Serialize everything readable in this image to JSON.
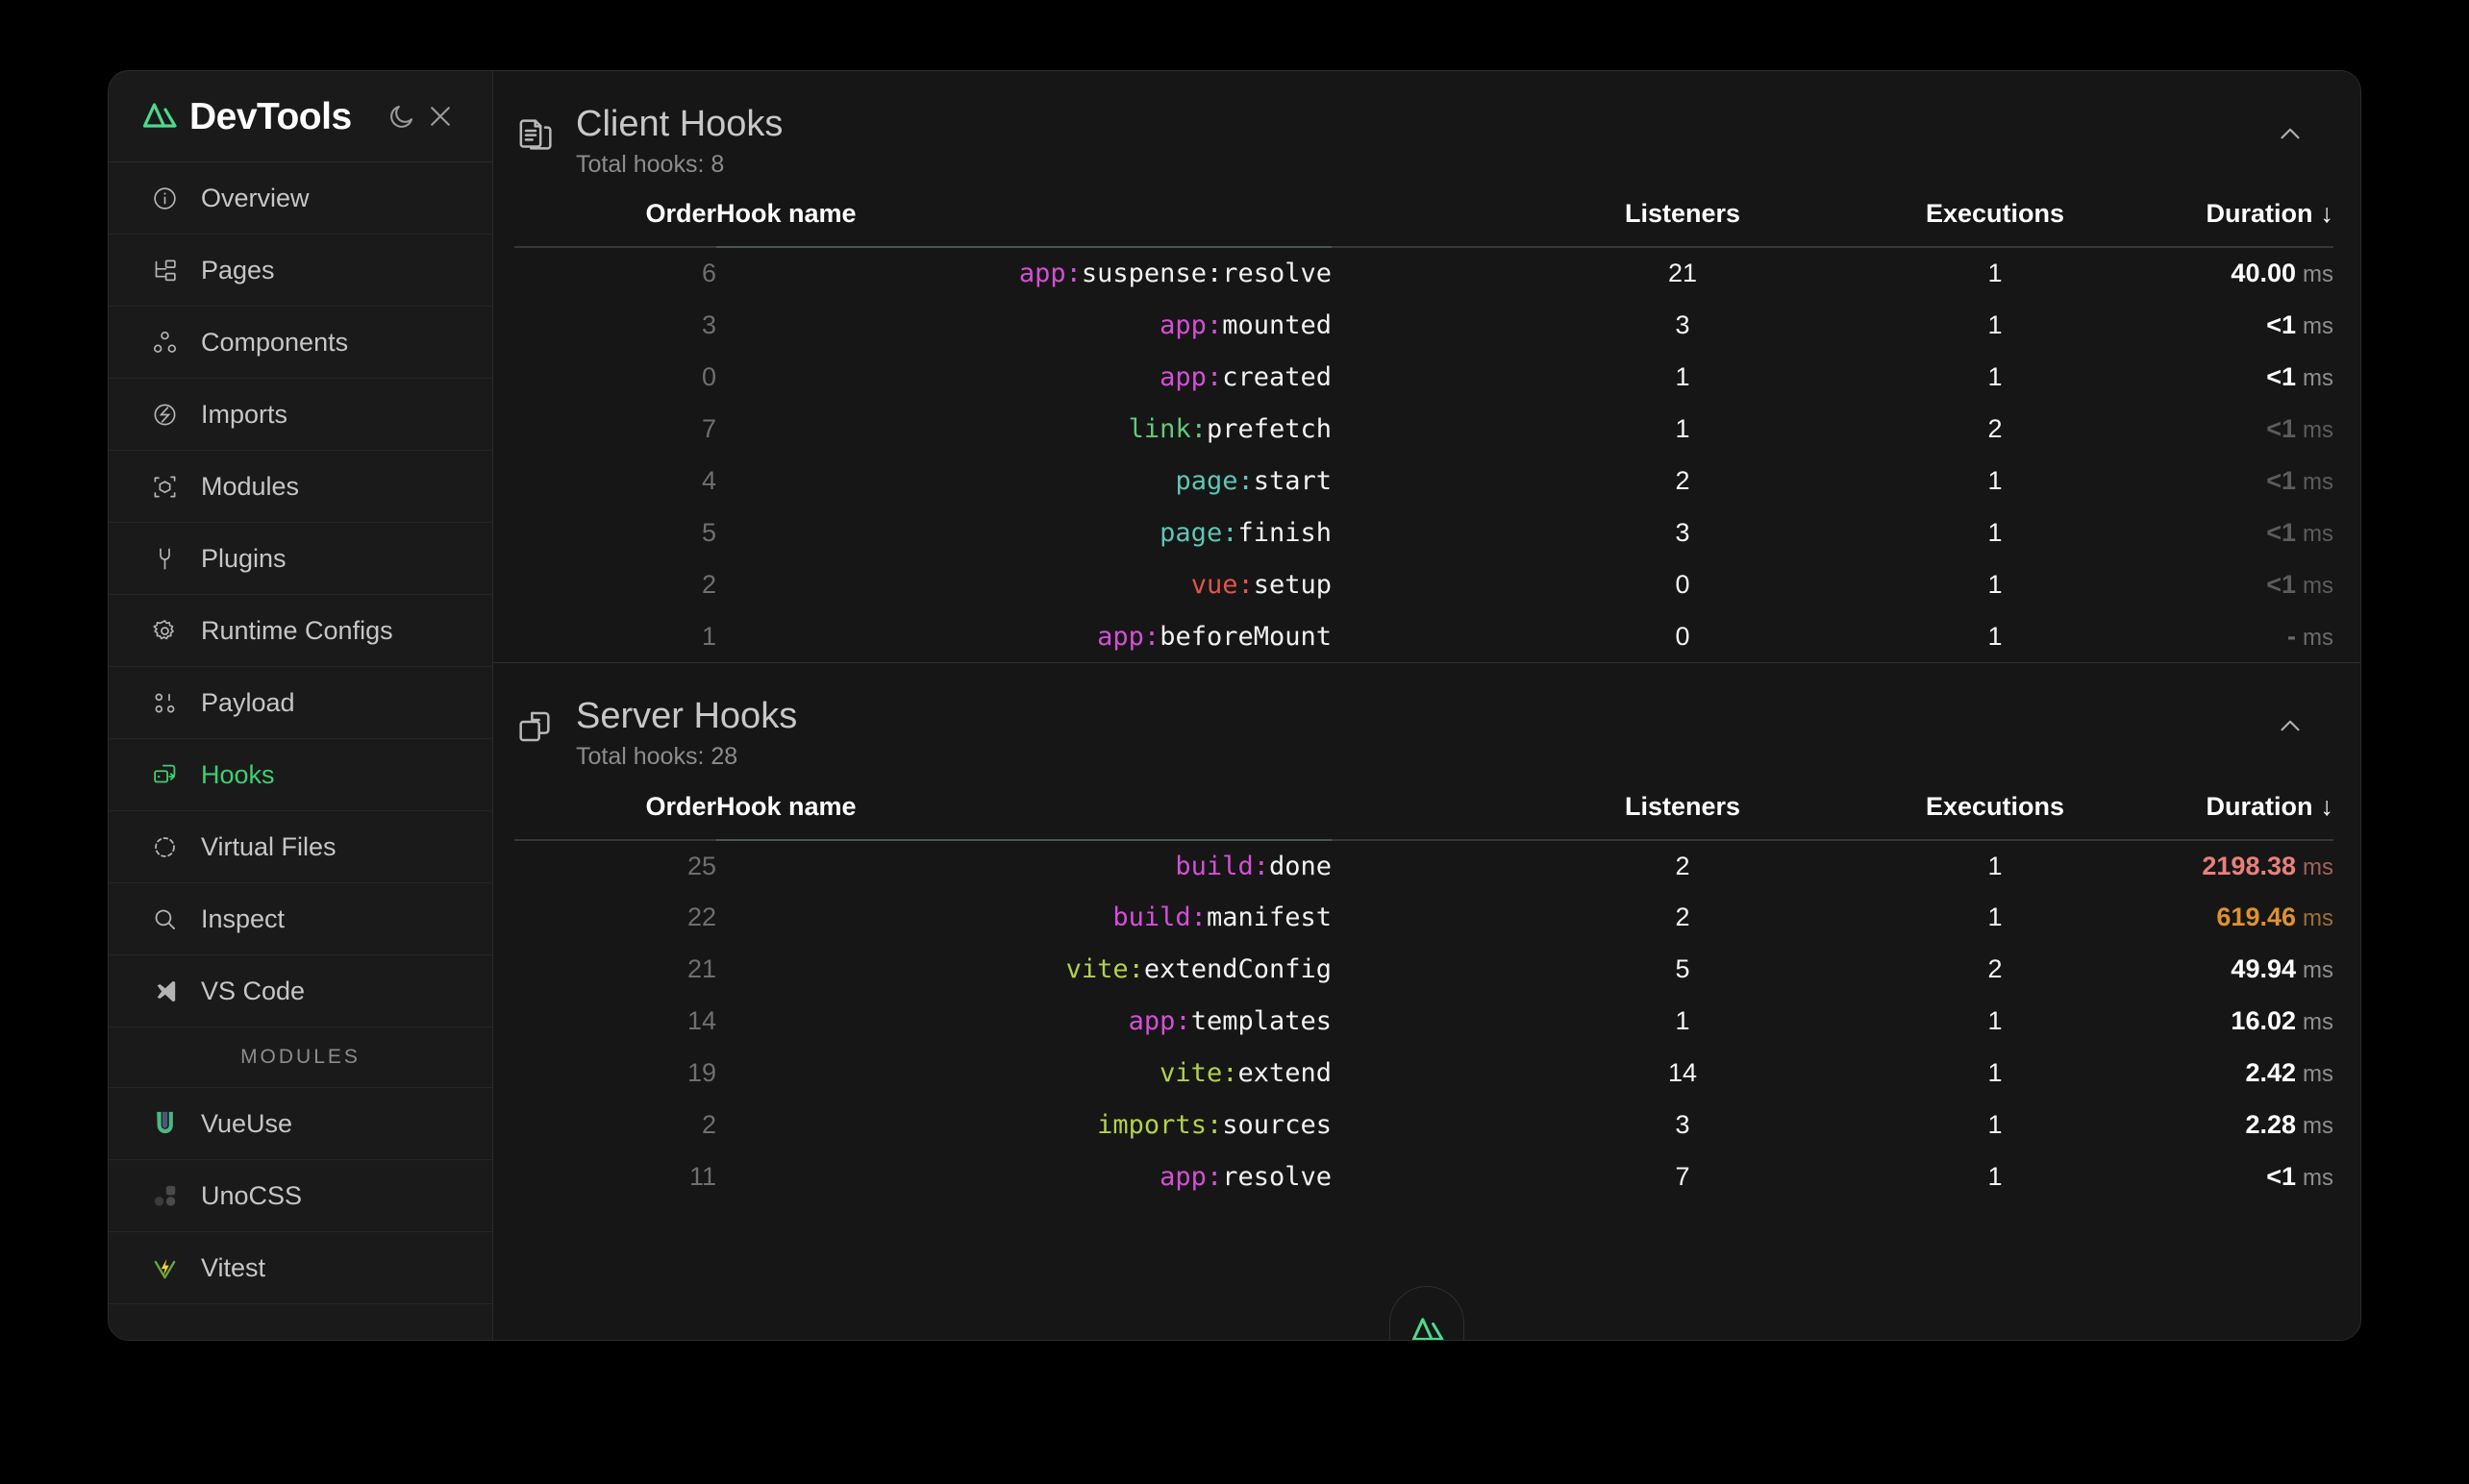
{
  "app": {
    "brand_name": "DevTools",
    "theme_toggle": "moon-icon",
    "close": "close-icon"
  },
  "sidebar": {
    "items": [
      {
        "label": "Overview",
        "icon": "info-circle-icon",
        "active": false
      },
      {
        "label": "Pages",
        "icon": "sitemap-icon",
        "active": false
      },
      {
        "label": "Components",
        "icon": "nodes-icon",
        "active": false
      },
      {
        "label": "Imports",
        "icon": "magnet-icon",
        "active": false
      },
      {
        "label": "Modules",
        "icon": "cube-icon",
        "active": false
      },
      {
        "label": "Plugins",
        "icon": "plug-icon",
        "active": false
      },
      {
        "label": "Runtime Configs",
        "icon": "gear-icon",
        "active": false
      },
      {
        "label": "Payload",
        "icon": "payload-icon",
        "active": false
      },
      {
        "label": "Hooks",
        "icon": "hooks-icon",
        "active": true
      },
      {
        "label": "Virtual Files",
        "icon": "dashed-circle-icon",
        "active": false
      },
      {
        "label": "Inspect",
        "icon": "search-icon",
        "active": false
      },
      {
        "label": "VS Code",
        "icon": "vscode-icon",
        "active": false
      }
    ],
    "section_title": "MODULES",
    "modules": [
      {
        "label": "VueUse",
        "icon": "vueuse-icon"
      },
      {
        "label": "UnoCSS",
        "icon": "unocss-icon"
      },
      {
        "label": "Vitest",
        "icon": "vitest-icon"
      }
    ]
  },
  "columns": {
    "order": "Order",
    "hook_name": "Hook name",
    "listeners": "Listeners",
    "executions": "Executions",
    "duration": "Duration",
    "sort_indicator": "↓"
  },
  "colors": {
    "accent_green": "#3fcf71",
    "prefix_app": "#d44fd6",
    "prefix_link": "#64c97b",
    "prefix_page": "#5ec5b6",
    "prefix_vue": "#e0544a",
    "prefix_build": "#d44fd6",
    "prefix_vite": "#b2d24c",
    "prefix_imports": "#b2d24c",
    "duration_critical": "#e8807b",
    "duration_warning": "#e0912f",
    "duration_normal": "#ffffff"
  },
  "sections": [
    {
      "title": "Client Hooks",
      "subtitle": "Total hooks: 8",
      "icon": "client-hooks-icon",
      "collapse_icon": "chevron-up-icon",
      "rows": [
        {
          "order": "6",
          "prefix": "app:",
          "prefix_color": "#d44fd6",
          "name": "suspense:resolve",
          "listeners": "21",
          "executions": "1",
          "duration": "40.00",
          "unit": "ms",
          "duration_color": "#ffffff",
          "unit_color": "#8f8f8f"
        },
        {
          "order": "3",
          "prefix": "app:",
          "prefix_color": "#d44fd6",
          "name": "mounted",
          "listeners": "3",
          "executions": "1",
          "duration": "<1",
          "unit": "ms",
          "duration_color": "#ffffff",
          "unit_color": "#8f8f8f"
        },
        {
          "order": "0",
          "prefix": "app:",
          "prefix_color": "#d44fd6",
          "name": "created",
          "listeners": "1",
          "executions": "1",
          "duration": "<1",
          "unit": "ms",
          "duration_color": "#ffffff",
          "unit_color": "#8f8f8f"
        },
        {
          "order": "7",
          "prefix": "link:",
          "prefix_color": "#64c97b",
          "name": "prefetch",
          "listeners": "1",
          "executions": "2",
          "duration": "<1",
          "unit": "ms",
          "duration_color": "#5c5c5c",
          "unit_color": "#5c5c5c"
        },
        {
          "order": "4",
          "prefix": "page:",
          "prefix_color": "#5ec5b6",
          "name": "start",
          "listeners": "2",
          "executions": "1",
          "duration": "<1",
          "unit": "ms",
          "duration_color": "#5c5c5c",
          "unit_color": "#5c5c5c"
        },
        {
          "order": "5",
          "prefix": "page:",
          "prefix_color": "#5ec5b6",
          "name": "finish",
          "listeners": "3",
          "executions": "1",
          "duration": "<1",
          "unit": "ms",
          "duration_color": "#5c5c5c",
          "unit_color": "#5c5c5c"
        },
        {
          "order": "2",
          "prefix": "vue:",
          "prefix_color": "#e0544a",
          "name": "setup",
          "listeners": "0",
          "executions": "1",
          "duration": "<1",
          "unit": "ms",
          "duration_color": "#5c5c5c",
          "unit_color": "#5c5c5c"
        },
        {
          "order": "1",
          "prefix": "app:",
          "prefix_color": "#d44fd6",
          "name": "beforeMount",
          "listeners": "0",
          "executions": "1",
          "duration": "-",
          "unit": "ms",
          "duration_color": "#6b6b6b",
          "unit_color": "#6b6b6b"
        }
      ]
    },
    {
      "title": "Server Hooks",
      "subtitle": "Total hooks: 28",
      "icon": "server-hooks-icon",
      "collapse_icon": "chevron-up-icon",
      "rows": [
        {
          "order": "25",
          "prefix": "build:",
          "prefix_color": "#d44fd6",
          "name": "done",
          "listeners": "2",
          "executions": "1",
          "duration": "2198.38",
          "unit": "ms",
          "duration_color": "#e8807b",
          "unit_color": "#a06260"
        },
        {
          "order": "22",
          "prefix": "build:",
          "prefix_color": "#d44fd6",
          "name": "manifest",
          "listeners": "2",
          "executions": "1",
          "duration": "619.46",
          "unit": "ms",
          "duration_color": "#e0912f",
          "unit_color": "#9a7035"
        },
        {
          "order": "21",
          "prefix": "vite:",
          "prefix_color": "#b2d24c",
          "name": "extendConfig",
          "listeners": "5",
          "executions": "2",
          "duration": "49.94",
          "unit": "ms",
          "duration_color": "#ffffff",
          "unit_color": "#8f8f8f"
        },
        {
          "order": "14",
          "prefix": "app:",
          "prefix_color": "#d44fd6",
          "name": "templates",
          "listeners": "1",
          "executions": "1",
          "duration": "16.02",
          "unit": "ms",
          "duration_color": "#ffffff",
          "unit_color": "#8f8f8f"
        },
        {
          "order": "19",
          "prefix": "vite:",
          "prefix_color": "#b2d24c",
          "name": "extend",
          "listeners": "14",
          "executions": "1",
          "duration": "2.42",
          "unit": "ms",
          "duration_color": "#ffffff",
          "unit_color": "#8f8f8f"
        },
        {
          "order": "2",
          "prefix": "imports:",
          "prefix_color": "#b2d24c",
          "name": "sources",
          "listeners": "3",
          "executions": "1",
          "duration": "2.28",
          "unit": "ms",
          "duration_color": "#ffffff",
          "unit_color": "#8f8f8f"
        },
        {
          "order": "11",
          "prefix": "app:",
          "prefix_color": "#d44fd6",
          "name": "resolve",
          "listeners": "7",
          "executions": "1",
          "duration": "<1",
          "unit": "ms",
          "duration_color": "#ffffff",
          "unit_color": "#8f8f8f"
        }
      ]
    }
  ],
  "bottom_badge": "nuxt-logo-icon"
}
